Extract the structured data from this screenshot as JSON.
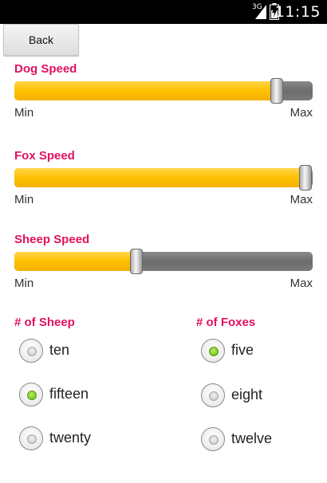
{
  "status_bar": {
    "network": "3G",
    "time": "11:15"
  },
  "back_button": {
    "label": "Back"
  },
  "sliders": [
    {
      "title": "Dog Speed",
      "min_label": "Min",
      "max_label": "Max",
      "value_fraction": 0.88
    },
    {
      "title": "Fox Speed",
      "min_label": "Min",
      "max_label": "Max",
      "value_fraction": 0.975
    },
    {
      "title": "Sheep Speed",
      "min_label": "Min",
      "max_label": "Max",
      "value_fraction": 0.41
    }
  ],
  "sheep_group": {
    "title": "# of Sheep",
    "options": [
      {
        "label": "ten",
        "selected": false
      },
      {
        "label": "fifteen",
        "selected": true
      },
      {
        "label": "twenty",
        "selected": false
      }
    ]
  },
  "fox_group": {
    "title": "# of Foxes",
    "options": [
      {
        "label": "five",
        "selected": true
      },
      {
        "label": "eight",
        "selected": false
      },
      {
        "label": "twelve",
        "selected": false
      }
    ]
  },
  "colors": {
    "accent": "#e0115f",
    "slider_fill": "#ffc000",
    "slider_track": "#777777",
    "radio_selected": "#7ac81e"
  }
}
